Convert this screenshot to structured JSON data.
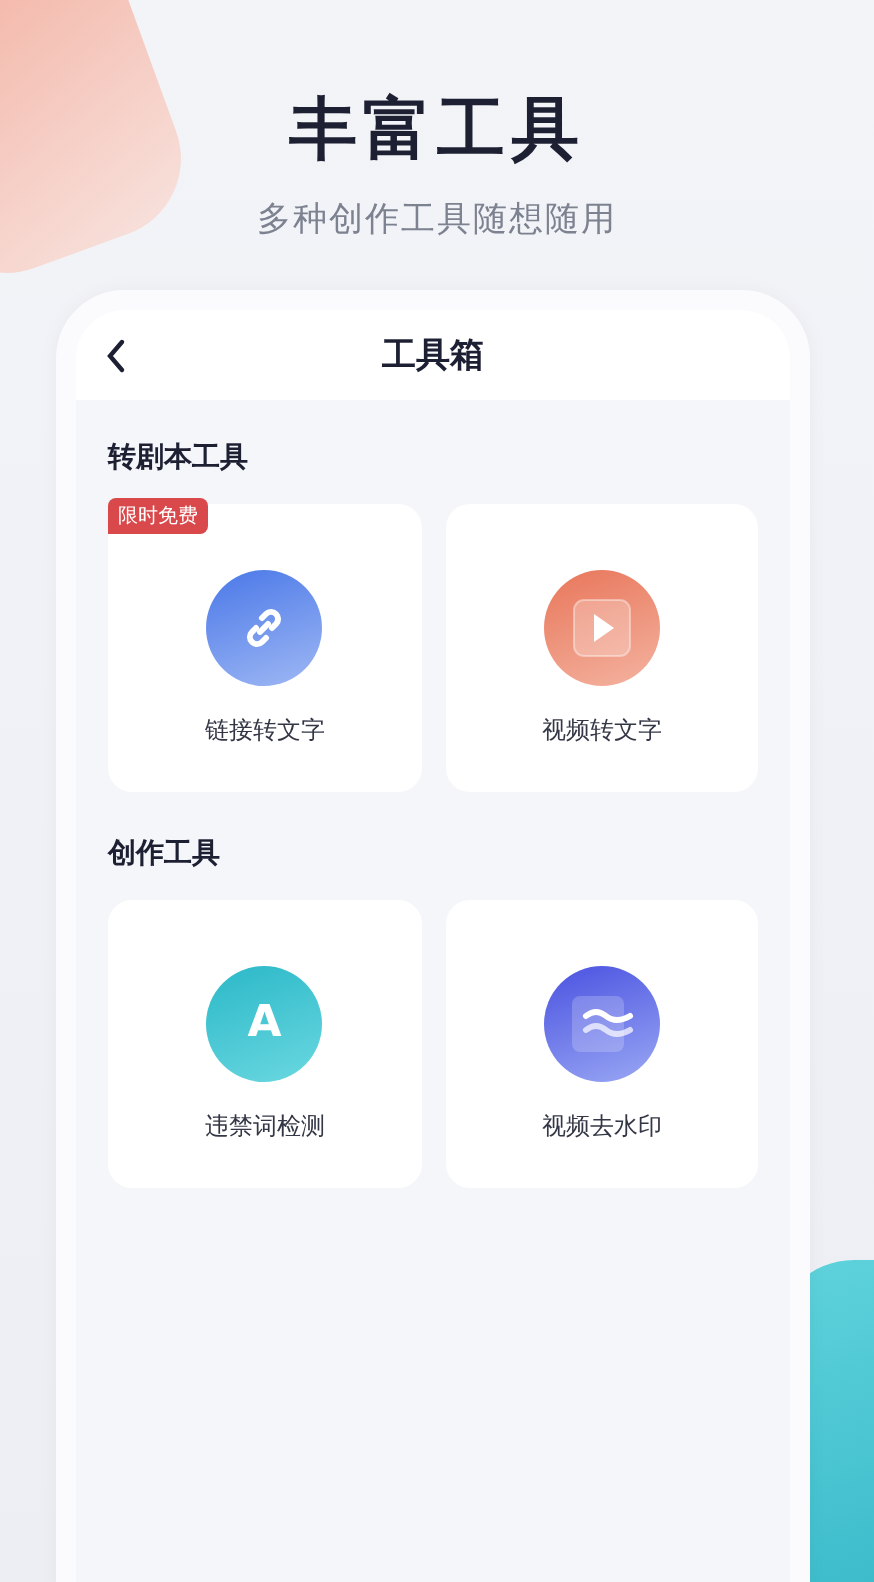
{
  "headline": "丰富工具",
  "subheadline": "多种创作工具随想随用",
  "screen": {
    "title": "工具箱",
    "sections": [
      {
        "title": "转剧本工具",
        "tools": [
          {
            "label": "链接转文字",
            "kind": "link",
            "badge": "限时免费"
          },
          {
            "label": "视频转文字",
            "kind": "play"
          }
        ]
      },
      {
        "title": "创作工具",
        "tools": [
          {
            "label": "违禁词检测",
            "kind": "letter",
            "glyph": "A"
          },
          {
            "label": "视频去水印",
            "kind": "waves"
          }
        ]
      }
    ]
  }
}
